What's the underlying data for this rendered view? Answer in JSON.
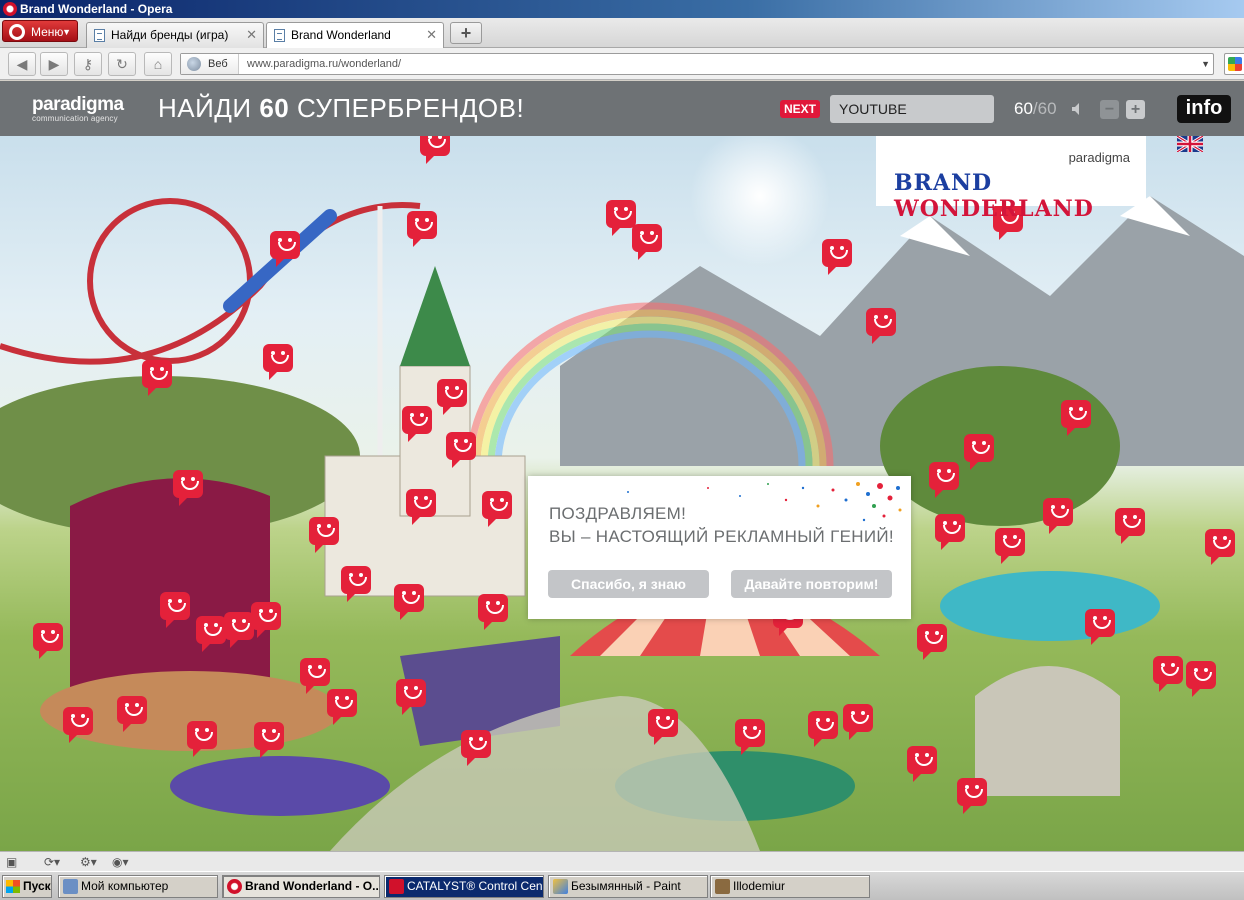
{
  "window": {
    "title": "Brand Wonderland - Opera"
  },
  "menu": {
    "label": "Меню"
  },
  "tabs": [
    {
      "label": "Найди бренды (игра)"
    },
    {
      "label": "Brand Wonderland"
    }
  ],
  "address": {
    "prefix": "Веб",
    "url": "www.paradigma.ru/wonderland/"
  },
  "site": {
    "logo_main": "paradigma",
    "logo_sub": "communication agency",
    "headline_pre": "НАЙДИ",
    "headline_num": "60",
    "headline_post": "СУПЕРБРЕНДОВ!",
    "next_label": "NEXT",
    "brand_input_value": "YOUTUBE",
    "found": "60",
    "total": "/60",
    "zoom_out_label": "−",
    "zoom_in_label": "+",
    "info_label": "info",
    "panel_paradigma": "paradigma",
    "panel_title_b": "BRAND",
    "panel_title_w": "WONDERLAND"
  },
  "dialog": {
    "line1": "ПОЗДРАВЛЯЕМ!",
    "line2": "ВЫ – НАСТОЯЩИЙ РЕКЛАМНЫЙ ГЕНИЙ!",
    "button_know": "Спасибо, я знаю",
    "button_repeat": "Давайте повторим!"
  },
  "taskbar": {
    "start": "Пуск",
    "items": [
      {
        "label": "Мой компьютер"
      },
      {
        "label": "Brand Wonderland - O..."
      },
      {
        "label": "CATALYST® Control Cen..."
      },
      {
        "label": "Безымянный - Paint"
      },
      {
        "label": "Illodemiur"
      }
    ]
  },
  "colors": {
    "accent_red": "#e4213a",
    "header_gray": "#6e7275"
  }
}
